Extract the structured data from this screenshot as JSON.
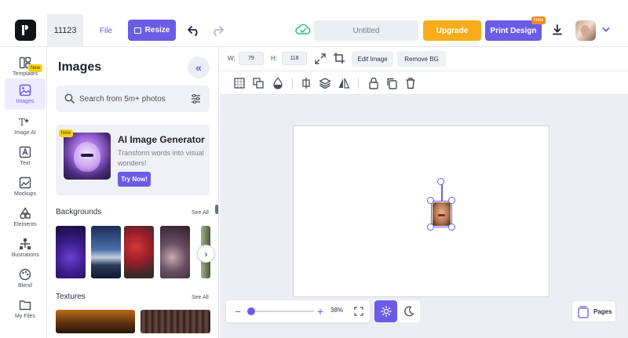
{
  "header": {
    "doc_id": "11123",
    "file_label": "File",
    "resize_label": "Resize",
    "title_value": "Untitled",
    "upgrade_label": "Upgrade",
    "print_label": "Print Design",
    "print_badge": "New"
  },
  "nav": {
    "items": [
      {
        "label": "Templates",
        "icon": "templates-icon"
      },
      {
        "label": "Images",
        "icon": "image-icon",
        "active": true
      },
      {
        "label": "Image AI",
        "icon": "image-ai-icon",
        "badge": "New"
      },
      {
        "label": "Text",
        "icon": "text-icon"
      },
      {
        "label": "Mockups",
        "icon": "mockups-icon"
      },
      {
        "label": "Elements",
        "icon": "elements-icon"
      },
      {
        "label": "Illustrations",
        "icon": "illustrations-icon"
      },
      {
        "label": "Blend",
        "icon": "blend-icon"
      },
      {
        "label": "My Files",
        "icon": "folder-icon"
      }
    ]
  },
  "panel": {
    "title": "Images",
    "search_placeholder": "Search from 5m+ photos",
    "promo": {
      "badge": "New",
      "title": "AI Image Generator",
      "description": "Transform words into visual wonders!",
      "button": "Try Now!"
    },
    "backgrounds": {
      "title": "Backgrounds",
      "see_all": "See All"
    },
    "textures": {
      "title": "Textures",
      "see_all": "See All"
    }
  },
  "toolbar": {
    "width_label": "W:",
    "width_value": "79",
    "height_label": "H:",
    "height_value": "118",
    "edit_image": "Edit Image",
    "remove_bg": "Remove BG"
  },
  "zoom": {
    "value": "38%",
    "level_fraction": 0.38
  },
  "pages": {
    "label": "Pages"
  },
  "colors": {
    "accent": "#6b5ce7",
    "upgrade": "#f5ad1c",
    "badge": "#f7d21b"
  }
}
